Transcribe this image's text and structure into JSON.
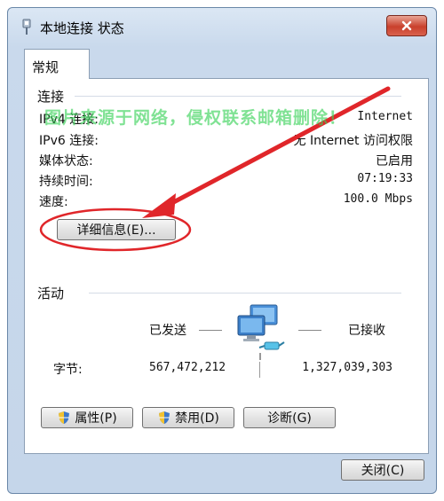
{
  "window": {
    "title": "本地连接 状态",
    "close_icon": "close-icon"
  },
  "tabs": [
    {
      "label": "常规",
      "active": true
    }
  ],
  "connection": {
    "section_title": "连接",
    "rows": [
      {
        "label": "IPv4 连接:",
        "value": "Internet"
      },
      {
        "label": "IPv6 连接:",
        "value": "无 Internet 访问权限"
      },
      {
        "label": "媒体状态:",
        "value": "已启用"
      },
      {
        "label": "持续时间:",
        "value": "07:19:33"
      },
      {
        "label": "速度:",
        "value": "100.0 Mbps"
      }
    ],
    "details_button": "详细信息(E)..."
  },
  "activity": {
    "section_title": "活动",
    "sent_label": "已发送",
    "received_label": "已接收",
    "bytes_label": "字节:",
    "bytes_sent": "567,472,212",
    "bytes_received": "1,327,039,303"
  },
  "buttons": {
    "properties": "属性(P)",
    "disable": "禁用(D)",
    "diagnose": "诊断(G)",
    "close": "关闭(C)"
  },
  "overlay": {
    "watermark": "图片来源于网络，侵权联系邮箱删除！",
    "annotation_color": "#e0262a"
  },
  "colors": {
    "title_gradient_top": "#dbe7f4",
    "close_button_red": "#c9402c",
    "watermark_green": "#3cd25a"
  }
}
